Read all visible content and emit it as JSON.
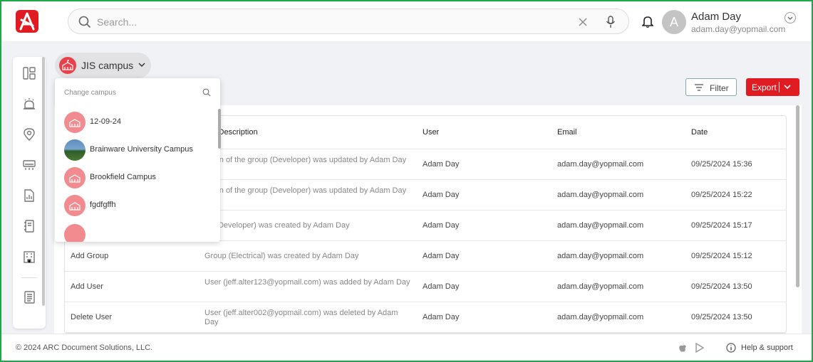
{
  "header": {
    "search_placeholder": "Search...",
    "user_initial": "A",
    "user_name": "Adam Day",
    "user_email": "adam.day@yopmail.com"
  },
  "campus_selector": {
    "selected": "JIS campus",
    "dropdown_header": "Change campus",
    "options": [
      {
        "label": "12-09-24",
        "icon": "building-icon"
      },
      {
        "label": "Brainware University Campus",
        "icon": "campus-photo"
      },
      {
        "label": "Brookfield Campus",
        "icon": "building-icon"
      },
      {
        "label": "fgdfgffh",
        "icon": "building-icon"
      }
    ]
  },
  "toolbar": {
    "filter_label": "Filter",
    "export_label": "Export"
  },
  "table": {
    "columns": [
      "",
      "vity Description",
      "User",
      "Email",
      "Date"
    ],
    "rows": [
      {
        "activity": "",
        "description": "mtion of the group (Developer) was updated by Adam Day",
        "user": "Adam Day",
        "email": "adam.day@yopmail.com",
        "date": "09/25/2024 15:36"
      },
      {
        "activity": "",
        "description": "mtion of the group (Developer) was updated by Adam Day",
        "user": "Adam Day",
        "email": "adam.day@yopmail.com",
        "date": "09/25/2024 15:22"
      },
      {
        "activity": "",
        "description": "up (Developer) was created by Adam Day",
        "user": "Adam Day",
        "email": "adam.day@yopmail.com",
        "date": "09/25/2024 15:17"
      },
      {
        "activity": "Add Group",
        "description": "Group (Electrical) was created by Adam Day",
        "user": "Adam Day",
        "email": "adam.day@yopmail.com",
        "date": "09/25/2024 15:12"
      },
      {
        "activity": "Add User",
        "description": "User (jeff.alter123@yopmail.com) was added by Adam Day",
        "user": "Adam Day",
        "email": "adam.day@yopmail.com",
        "date": "09/25/2024 13:50"
      },
      {
        "activity": "Delete User",
        "description": "User (jeff.alter002@yopmail.com) was deleted by Adam Day",
        "user": "Adam Day",
        "email": "adam.day@yopmail.com",
        "date": "09/25/2024 13:50"
      }
    ]
  },
  "footer": {
    "copyright": "© 2024 ARC Document Solutions, LLC.",
    "help": "Help & support"
  },
  "colors": {
    "brand": "#e01b22",
    "frame": "#1fa84a",
    "campus_icon": "#e8414a"
  }
}
